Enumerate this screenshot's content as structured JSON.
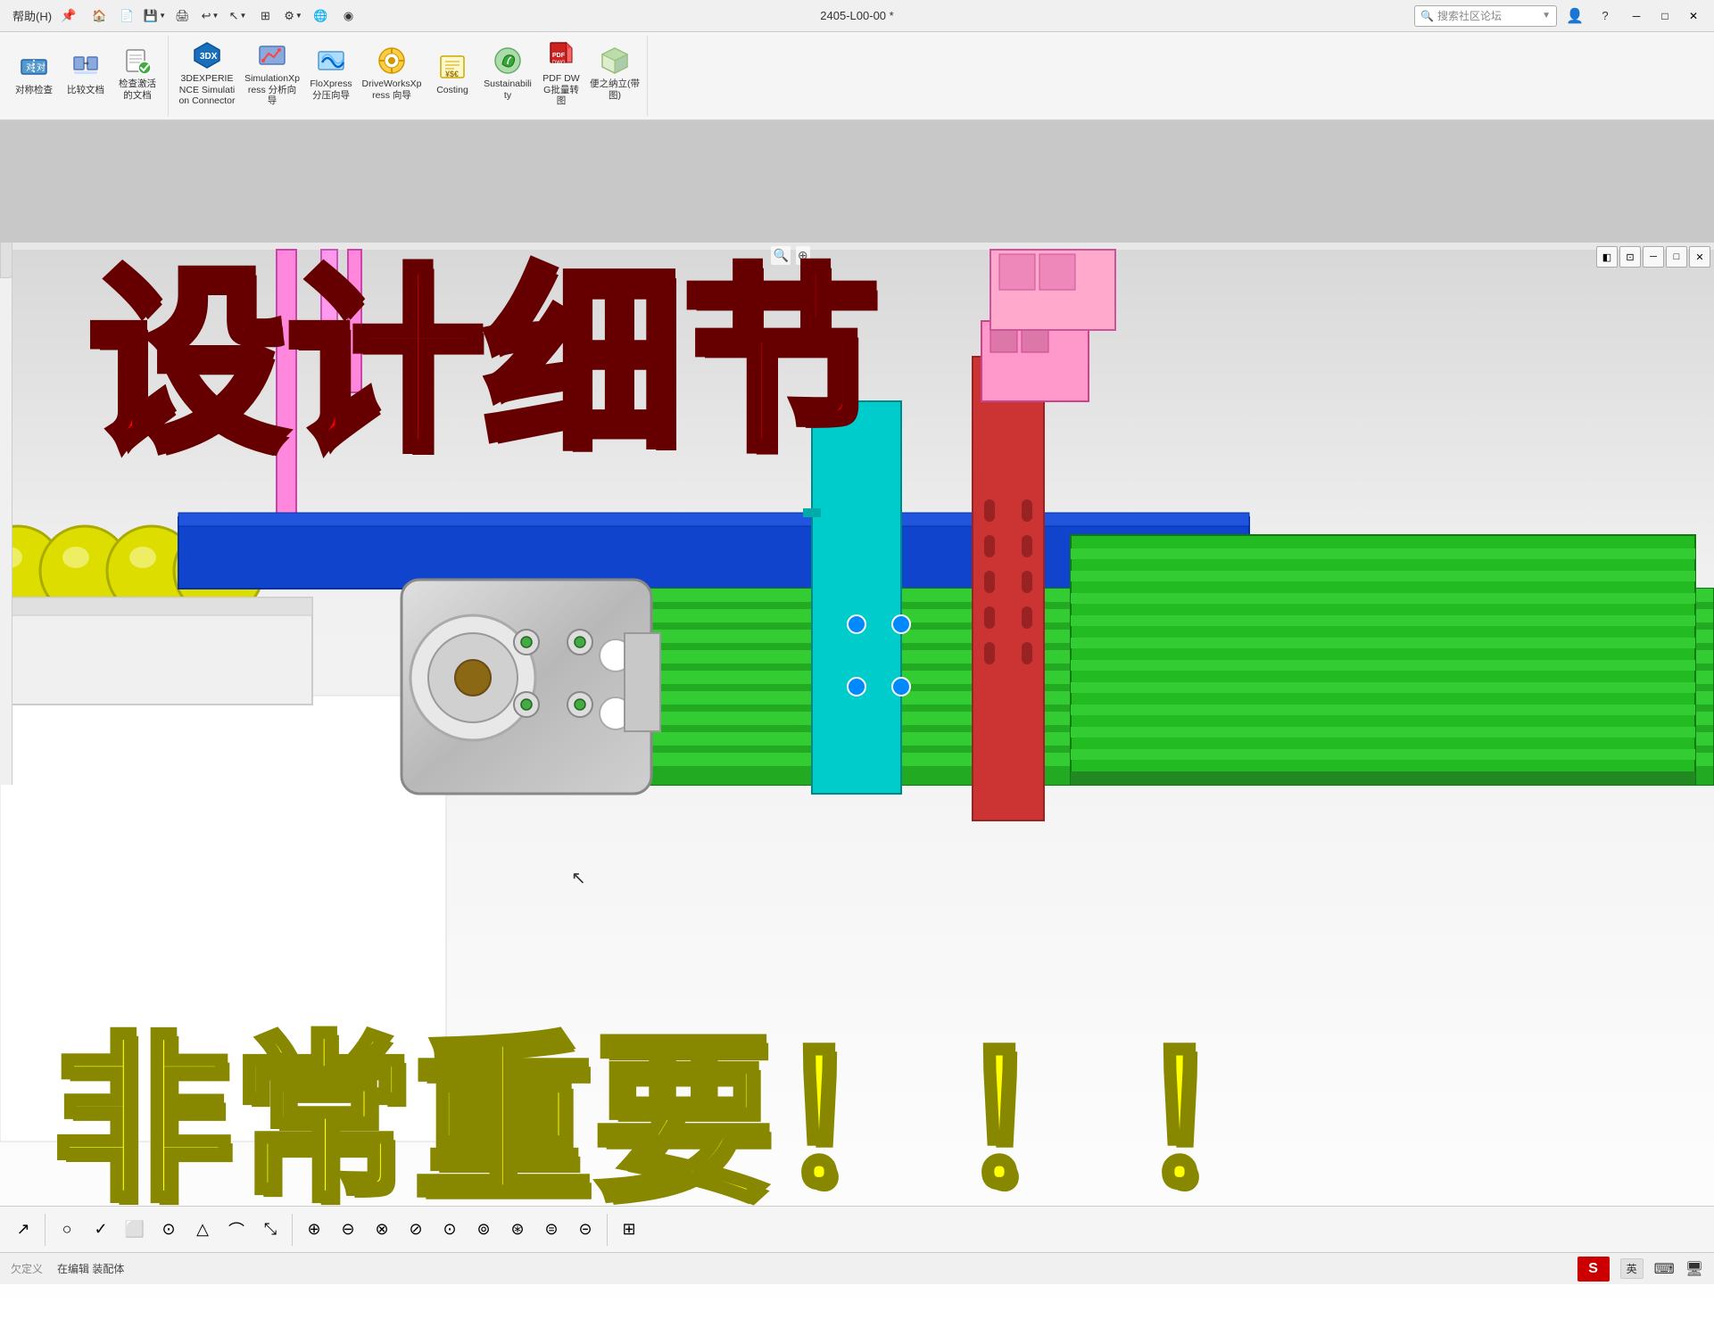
{
  "titlebar": {
    "help_menu": "帮助(H)",
    "pin_icon": "📌",
    "title": "2405-L00-00 *",
    "search_placeholder": "搜索社区论坛",
    "user_icon": "👤",
    "question_icon": "?",
    "minimize_label": "─",
    "maximize_label": "□",
    "close_label": "✕"
  },
  "toolbar": {
    "groups": [
      {
        "id": "symmetry",
        "items": [
          {
            "id": "symmetry-check",
            "label": "对称检\n查",
            "icon": "⊞"
          },
          {
            "id": "compare-docs",
            "label": "比较文\n档",
            "icon": "⊟"
          },
          {
            "id": "check-active",
            "label": "检查激\n活的文档",
            "icon": "☑"
          }
        ]
      },
      {
        "id": "xpress",
        "items": [
          {
            "id": "3dexperience",
            "label": "3DEXPERIENCE\nSimulation\nConnector",
            "icon": "⬡"
          },
          {
            "id": "simulation-xpress",
            "label": "SimulationXpress\n分析向导",
            "icon": "▦"
          },
          {
            "id": "flo-xpress",
            "label": "FloXpress\n分压向\n导",
            "icon": "≋"
          },
          {
            "id": "drive-works",
            "label": "DriveWorksXpress\n向导",
            "icon": "⚙"
          },
          {
            "id": "costing",
            "label": "Costing",
            "icon": "💰"
          },
          {
            "id": "sustainability",
            "label": "Sustainability",
            "icon": "🌿"
          },
          {
            "id": "pdf-dwg",
            "label": "PDF\nDWG批\n量转图",
            "icon": "📄"
          },
          {
            "id": "立体图",
            "label": "便之纳\n立(带图)",
            "icon": "📐"
          }
        ]
      }
    ]
  },
  "main": {
    "overlay_title": "设计细节",
    "overlay_important": "非常重要！！！",
    "cursor_symbol": "🖱"
  },
  "viewport_controls": {
    "expand": "⊞",
    "view1": "◧",
    "view2": "⊡",
    "minimize": "─",
    "restore": "□",
    "close": "✕"
  },
  "statusbar": {
    "spelling": "欠定义",
    "mode": "在编辑 装配体",
    "language": "英",
    "right_icons": [
      "🌐",
      "⌨",
      "💻"
    ]
  },
  "bottom_toolbar": {
    "tools": [
      "↗",
      "○",
      "✓",
      "□",
      "⊙",
      "△",
      "⌒",
      "⤡",
      "⊕",
      "⊖",
      "⊗",
      "⊘",
      "⊙",
      "⊚",
      "⊛",
      "⊜",
      "⊝",
      "⊞"
    ]
  }
}
